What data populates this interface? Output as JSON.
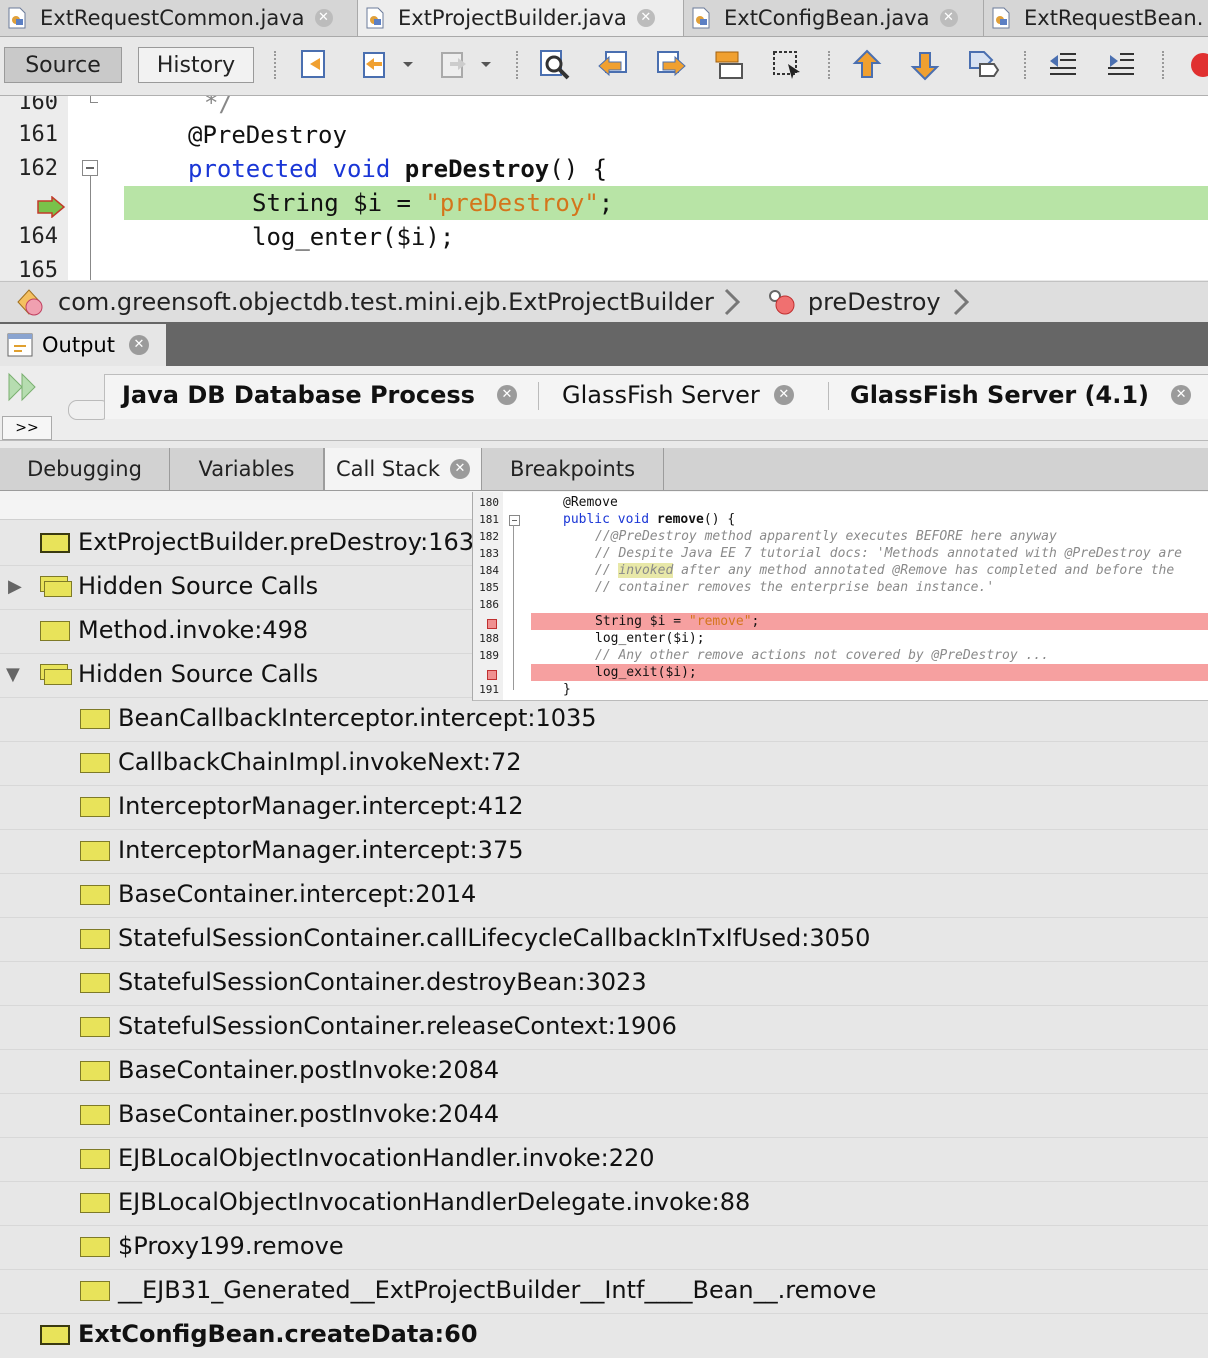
{
  "editor_tabs": [
    {
      "label": "ExtRequestCommon.java",
      "active": false
    },
    {
      "label": "ExtProjectBuilder.java",
      "active": true
    },
    {
      "label": "ExtConfigBean.java",
      "active": false
    },
    {
      "label": "ExtRequestBean.",
      "active": false
    }
  ],
  "toolbar": {
    "source_label": "Source",
    "history_label": "History"
  },
  "code": {
    "line_numbers": [
      "160",
      "161",
      "162",
      "",
      "164",
      "165"
    ],
    "lines": {
      "l160": "*/",
      "l161": "@PreDestroy",
      "l162_kw1": "protected",
      "l162_kw2": "void",
      "l162_name": "preDestroy",
      "l162_rest": "() {",
      "l163_pre": "String $i = ",
      "l163_str": "\"preDestroy\"",
      "l163_post": ";",
      "l164": "log_enter($i);"
    }
  },
  "breadcrumb": {
    "class_path": "com.greensoft.objectdb.test.mini.ejb.ExtProjectBuilder",
    "method": "preDestroy"
  },
  "output": {
    "title": "Output",
    "tabs": [
      {
        "label": "Java DB Database Process"
      },
      {
        "label": "GlassFish Server"
      },
      {
        "label": "GlassFish Server (4.1)"
      }
    ],
    "expand_label": ">>"
  },
  "debug_tabs": [
    {
      "label": "Debugging"
    },
    {
      "label": "Variables"
    },
    {
      "label": "Call Stack"
    },
    {
      "label": "Breakpoints"
    }
  ],
  "call_stack": [
    {
      "label": "ExtProjectBuilder.preDestroy:163",
      "indent": 0,
      "expander": ""
    },
    {
      "label": "Hidden Source Calls",
      "indent": 0,
      "expander": "collapsed"
    },
    {
      "label": "Method.invoke:498",
      "indent": 0,
      "expander": ""
    },
    {
      "label": "Hidden Source Calls",
      "indent": 0,
      "expander": "expanded"
    },
    {
      "label": "BeanCallbackInterceptor.intercept:1035",
      "indent": 1
    },
    {
      "label": "CallbackChainImpl.invokeNext:72",
      "indent": 1
    },
    {
      "label": "InterceptorManager.intercept:412",
      "indent": 1
    },
    {
      "label": "InterceptorManager.intercept:375",
      "indent": 1
    },
    {
      "label": "BaseContainer.intercept:2014",
      "indent": 1
    },
    {
      "label": "StatefulSessionContainer.callLifecycleCallbackInTxIfUsed:3050",
      "indent": 1
    },
    {
      "label": "StatefulSessionContainer.destroyBean:3023",
      "indent": 1
    },
    {
      "label": "StatefulSessionContainer.releaseContext:1906",
      "indent": 1
    },
    {
      "label": "BaseContainer.postInvoke:2084",
      "indent": 1
    },
    {
      "label": "BaseContainer.postInvoke:2044",
      "indent": 1
    },
    {
      "label": "EJBLocalObjectInvocationHandler.invoke:220",
      "indent": 1
    },
    {
      "label": "EJBLocalObjectInvocationHandlerDelegate.invoke:88",
      "indent": 1
    },
    {
      "label": "$Proxy199.remove",
      "indent": 1
    },
    {
      "label": "__EJB31_Generated__ExtProjectBuilder__Intf____Bean__.remove",
      "indent": 1
    },
    {
      "label": "ExtConfigBean.createData:60",
      "indent": 0,
      "bold": true
    }
  ],
  "tooltip": {
    "line_numbers": [
      "180",
      "181",
      "182",
      "183",
      "184",
      "185",
      "186",
      "",
      "188",
      "189",
      "",
      "191"
    ],
    "l180": "@Remove",
    "l181_kw": "public void ",
    "l181_name": "remove",
    "l181_rest": "() {",
    "l182": "//@PreDestroy method apparently executes BEFORE here anyway",
    "l183": "// Despite Java EE 7 tutorial docs: 'Methods annotated with @PreDestroy are",
    "l184_pre": "// ",
    "l184_hl": "invoked",
    "l184_post": " after any method annotated @Remove has completed and before the",
    "l185": "// container removes the enterprise bean instance.'",
    "l187_pre": "String $i = ",
    "l187_str": "\"remove\"",
    "l187_post": ";",
    "l188": "log_enter($i);",
    "l189": "// Any other remove actions not covered by @PreDestroy ...",
    "l190": "log_exit($i);",
    "l191": "}"
  },
  "colors": {
    "current_line": "#b8e4a6",
    "breakpoint_line": "#f6a0a0",
    "keyword": "#1a36d6",
    "string": "#d4751b",
    "frame_icon": "#e8e35a"
  },
  "icons": {
    "java_file": "java-file-icon",
    "current_pc": "program-counter-arrow-icon",
    "breakpoint": "breakpoint-icon",
    "stack_frame": "stack-frame-icon"
  }
}
